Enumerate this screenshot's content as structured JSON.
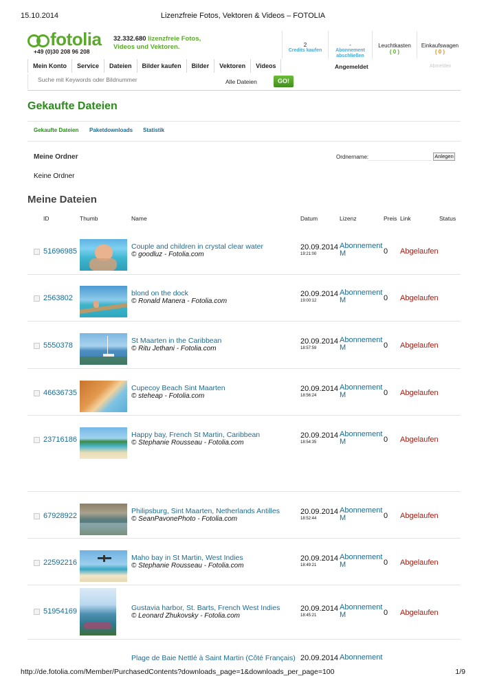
{
  "print_header": {
    "date": "15.10.2014",
    "title": "Lizenzfreie Fotos, Vektoren & Videos – FOTOLIA"
  },
  "print_footer": {
    "url": "http://de.fotolia.com/Member/PurchasedContents?downloads_page=1&downloads_per_page=100",
    "page": "1/9"
  },
  "brand": {
    "logo_text": "fotolia",
    "phone": "+49 (0)30 208 96 208",
    "count": "32.332.680",
    "tagline_a": " lizenzfreie Fotos,",
    "tagline_b": "Videos und Vektoren."
  },
  "account": {
    "credits_count": "2",
    "credits_label": "Credits kaufen",
    "abo_count": "-",
    "abo_label_a": "Abonnement",
    "abo_label_b": "abschließen",
    "lightbox_label": "Leuchtkasten",
    "lightbox_count": "( 0 )",
    "cart_label": "Einkaufswagen",
    "cart_count": "( 0 )"
  },
  "nav": {
    "items": [
      "Mein Konto",
      "Service",
      "Dateien",
      "Bilder kaufen",
      "Bilder",
      "Vektoren",
      "Videos"
    ],
    "status": "Angemeldet",
    "logout": "Abmelden"
  },
  "search": {
    "placeholder": "Suche mit Keywords oder Bildnummer",
    "scope": "Alle Dateien",
    "go": "GO!"
  },
  "page": {
    "heading": "Gekaufte Dateien",
    "tabs": [
      "Gekaufte Dateien",
      "Paketdownloads",
      "Statistik"
    ]
  },
  "folders": {
    "heading": "Meine Ordner",
    "name_label": "Ordnername:",
    "create_btn": "Anlegen",
    "empty": "Keine Ordner"
  },
  "files": {
    "heading": "Meine Dateien",
    "columns": {
      "id": "ID",
      "thumb": "Thumb",
      "name": "Name",
      "date": "Datum",
      "license": "Lizenz",
      "price": "Preis",
      "link": "Link",
      "status": "Status"
    },
    "rows": [
      {
        "id": "51696985",
        "name": "Couple and children in crystal clear water",
        "credit": "© goodluz - Fotolia.com",
        "date": "20.09.2014",
        "time": "19:21:00",
        "lic_a": "Abonnement",
        "lic_b": "M",
        "price": "0",
        "link": "Abgelaufen"
      },
      {
        "id": "2563802",
        "name": "blond on the dock",
        "credit": "© Ronald Manera - Fotolia.com",
        "date": "20.09.2014",
        "time": "19:00:12",
        "lic_a": "Abonnement",
        "lic_b": "M",
        "price": "0",
        "link": "Abgelaufen"
      },
      {
        "id": "5550378",
        "name": "St Maarten in the Caribbean",
        "credit": "© Ritu Jethani - Fotolia.com",
        "date": "20.09.2014",
        "time": "18:57:59",
        "lic_a": "Abonnement",
        "lic_b": "M",
        "price": "0",
        "link": "Abgelaufen"
      },
      {
        "id": "46636735",
        "name": "Cupecoy Beach Sint Maarten",
        "credit": "© steheap - Fotolia.com",
        "date": "20.09.2014",
        "time": "18:56:24",
        "lic_a": "Abonnement",
        "lic_b": "M",
        "price": "0",
        "link": "Abgelaufen"
      },
      {
        "id": "23716186",
        "name": "Happy bay, French St Martin, Caribbean",
        "credit": "© Stephanie Rousseau - Fotolia.com",
        "date": "20.09.2014",
        "time": "18:54:35",
        "lic_a": "Abonnement",
        "lic_b": "M",
        "price": "0",
        "link": "Abgelaufen"
      },
      {
        "id": "67928922",
        "name": "Philipsburg, Sint Maarten, Netherlands Antilles",
        "credit": "© SeanPavonePhoto - Fotolia.com",
        "date": "20.09.2014",
        "time": "18:52:44",
        "lic_a": "Abonnement",
        "lic_b": "M",
        "price": "0",
        "link": "Abgelaufen"
      },
      {
        "id": "22592216",
        "name": "Maho bay in St Martin, West Indies",
        "credit": "© Stephanie Rousseau - Fotolia.com",
        "date": "20.09.2014",
        "time": "18:49:21",
        "lic_a": "Abonnement",
        "lic_b": "M",
        "price": "0",
        "link": "Abgelaufen"
      },
      {
        "id": "51954169",
        "name": "Gustavia harbor, St. Barts, French West Indies",
        "credit": "© Leonard Zhukovsky - Fotolia.com",
        "date": "20.09.2014",
        "time": "18:45:21",
        "lic_a": "Abonnement",
        "lic_b": "M",
        "price": "0",
        "link": "Abgelaufen"
      }
    ],
    "partial_row": {
      "name": "Plage de Baie Nettlé à Saint Martin (Côté Français)",
      "date": "20.09.2014",
      "lic_a": "Abonnement"
    }
  }
}
